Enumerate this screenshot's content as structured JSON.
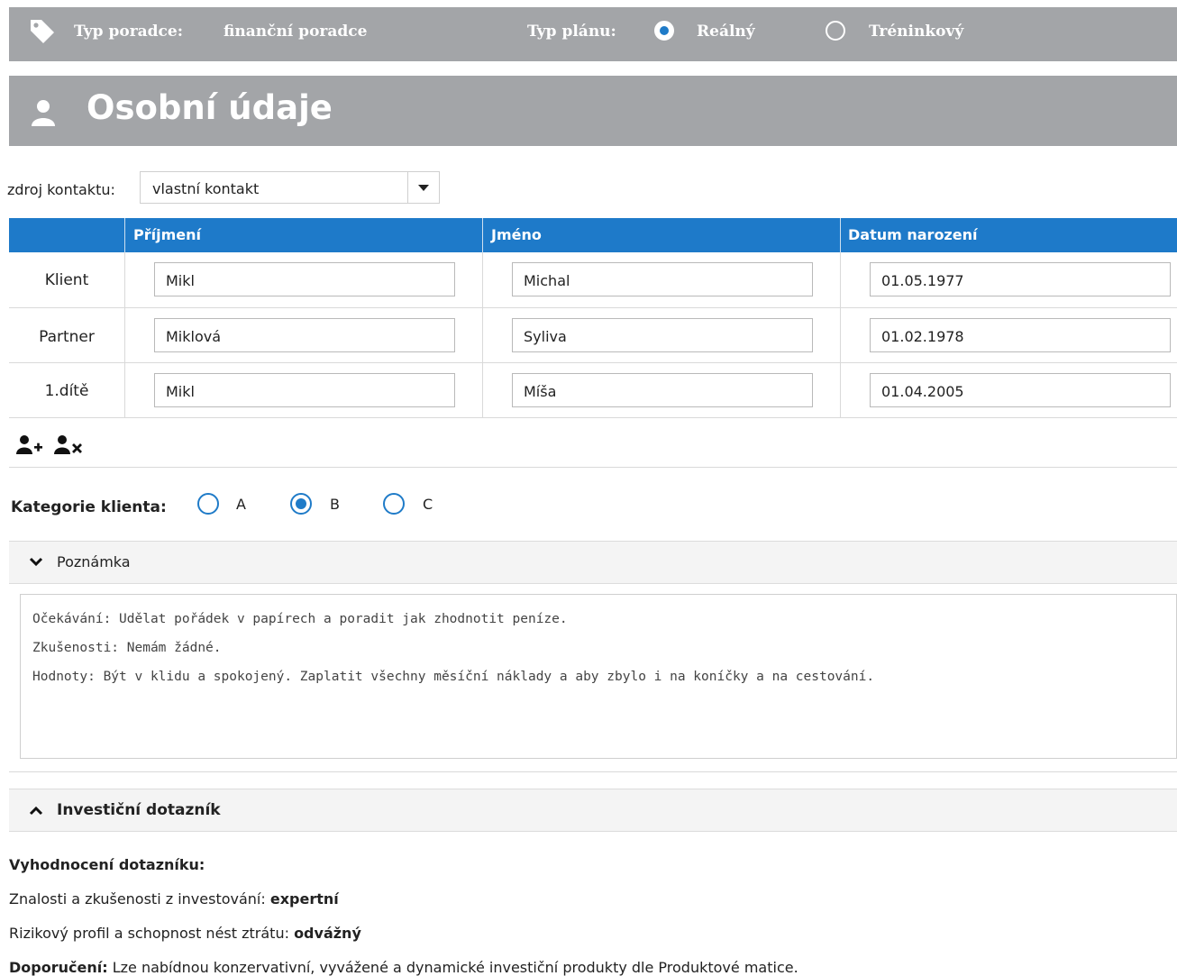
{
  "topbar": {
    "advisor_type_label": "Typ poradce:",
    "advisor_type_value": "finanční poradce",
    "plan_type_label": "Typ plánu:",
    "plan_options": [
      "Reálný",
      "Tréninkový"
    ],
    "plan_selected": "Reálný"
  },
  "page": {
    "title": "Osobní údaje"
  },
  "contact_source": {
    "label": "zdroj kontaktu:",
    "value": "vlastní kontakt"
  },
  "table": {
    "headers": [
      "Příjmení",
      "Jméno",
      "Datum narození"
    ],
    "rows": [
      {
        "role": "Klient",
        "surname": "Mikl",
        "name": "Michal",
        "birth": "01.05.1977"
      },
      {
        "role": "Partner",
        "surname": "Miklová",
        "name": "Syliva",
        "birth": "01.02.1978"
      },
      {
        "role": "1.dítě",
        "surname": "Mikl",
        "name": "Míša",
        "birth": "01.04.2005"
      }
    ]
  },
  "actions": {
    "add_icon": "add-person-icon",
    "remove_icon": "remove-person-icon"
  },
  "category": {
    "label": "Kategorie klienta:",
    "options": [
      "A",
      "B",
      "C"
    ],
    "selected": "B"
  },
  "note": {
    "header": "Poznámka",
    "lines": [
      "Očekávání: Udělat pořádek v papírech a poradit jak zhodnotit peníze.",
      "Zkušenosti: Nemám žádné.",
      "Hodnoty: Být v klidu a spokojený. Zaplatit všechny měsíční náklady a aby zbylo i na koníčky a na cestování."
    ]
  },
  "questionnaire": {
    "header": "Investiční dotazník",
    "evaluation_title": "Vyhodnocení dotazníku:",
    "knowledge_label": "Znalosti a zkušenosti z investování:",
    "knowledge_value": "expertní",
    "risk_label": "Rizikový profil a schopnost nést ztrátu:",
    "risk_value": "odvážný",
    "recommendation_label": "Doporučení:",
    "recommendation_text": "Lze nabídnou konzervativní, vyvážené a dynamické investiční produkty dle Produktové matice."
  },
  "colors": {
    "header_gray": "#a3a5a8",
    "accent_blue": "#1e7ac9"
  }
}
